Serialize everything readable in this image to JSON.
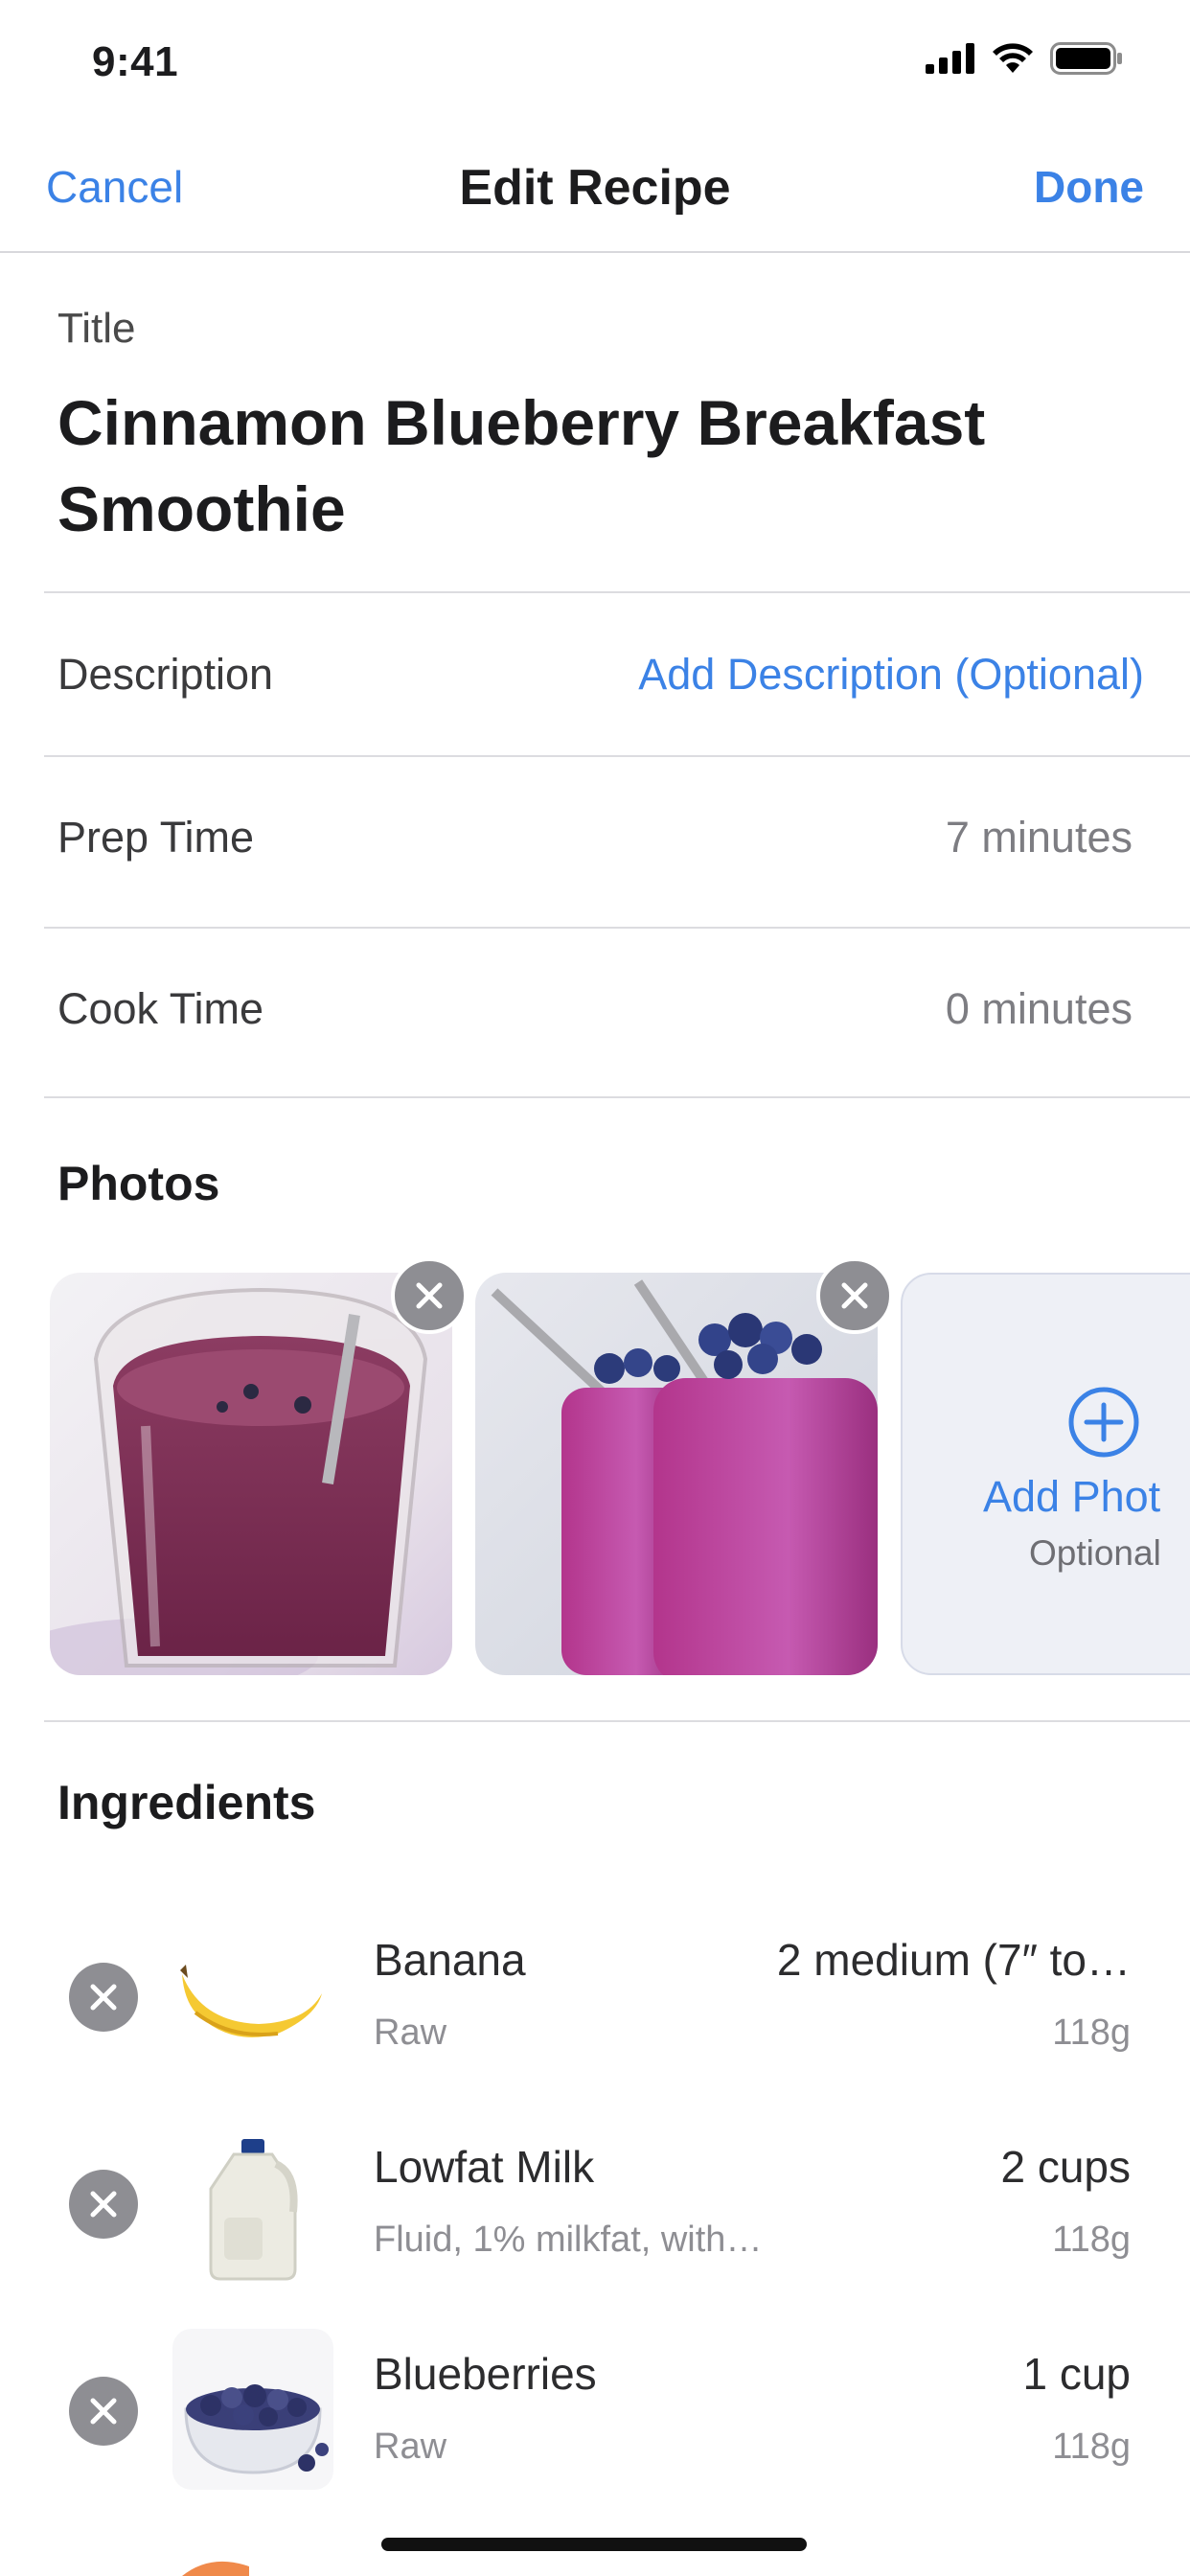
{
  "status_bar": {
    "time": "9:41"
  },
  "nav": {
    "cancel": "Cancel",
    "title": "Edit Recipe",
    "done": "Done"
  },
  "title_field": {
    "label": "Title",
    "value": "Cinnamon Blueberry Breakfast Smoothie"
  },
  "rows": {
    "description": {
      "label": "Description",
      "value": "Add Description (Optional)"
    },
    "prep_time": {
      "label": "Prep Time",
      "value": "7 minutes"
    },
    "cook_time": {
      "label": "Cook Time",
      "value": "0 minutes"
    }
  },
  "photos": {
    "title": "Photos",
    "add_label": "Add Phot",
    "add_sub": "Optional"
  },
  "ingredients": {
    "title": "Ingredients",
    "items": [
      {
        "name": "Banana",
        "sub": "Raw",
        "amount": "2 medium  (7″ to…",
        "weight": "118g"
      },
      {
        "name": "Lowfat Milk",
        "sub": "Fluid, 1% milkfat, with…",
        "amount": "2 cups",
        "weight": "118g"
      },
      {
        "name": "Blueberries",
        "sub": "Raw",
        "amount": "1 cup",
        "weight": "118g"
      }
    ]
  },
  "colors": {
    "accent": "#3b82e6",
    "remove_button": "#8e8e93"
  }
}
